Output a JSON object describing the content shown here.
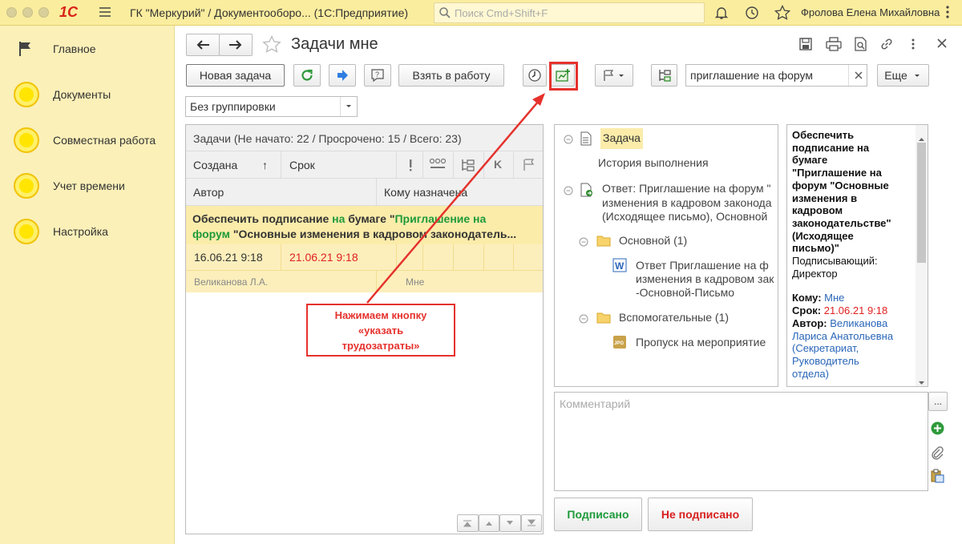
{
  "app": {
    "logo": "1С",
    "title": "ГК \"Меркурий\" / Документооборо...  (1С:Предприятие)",
    "search_placeholder": "Поиск Cmd+Shift+F",
    "user": "Фролова Елена Михайловна"
  },
  "sidebar": {
    "items": [
      {
        "label": "Главное"
      },
      {
        "label": "Документы"
      },
      {
        "label": "Совместная работа"
      },
      {
        "label": "Учет времени"
      },
      {
        "label": "Настройка"
      }
    ]
  },
  "form": {
    "title": "Задачи мне",
    "toolbar": {
      "new_task": "Новая задача",
      "take_to_work": "Взять в работу",
      "search_value": "приглашение на форум",
      "more": "Еще"
    },
    "grouping": "Без группировки"
  },
  "list": {
    "summary": "Задачи (Не начато: 22 / Просрочено: 15 / Всего: 23)",
    "columns": {
      "created": "Создана",
      "sort_arrow": "↑",
      "due": "Срок",
      "flag_k": "K",
      "author": "Автор",
      "assigned_to": "Кому назначена"
    },
    "rows": [
      {
        "title_part1": "Обеспечить подписание ",
        "title_part2": "на",
        "title_part3": " бумаге \"",
        "title_part4": "Приглашение на",
        "title_part5": "форум",
        "title_part6": " \"Основные изменения в кадровом законодатель...",
        "created": "16.06.21 9:18",
        "due": "21.06.21 9:18",
        "author": "Великанова Л.А.",
        "assigned_to": "Мне"
      }
    ]
  },
  "tree": {
    "task": "Задача",
    "history": "История выполнения",
    "answer_line1": "Ответ: Приглашение на форум \"",
    "answer_line2": "изменения в кадровом законода",
    "answer_line3": "(Исходящее письмо), Основной",
    "folder_main": "Основной (1)",
    "doc_line1": "Ответ  Приглашение на ф",
    "doc_line2": "изменения в кадровом зак",
    "doc_line3": "-Основной-Письмо",
    "folder_aux": "Вспомогательные (1)",
    "pass": "Пропуск на мероприятие"
  },
  "detail": {
    "heading": [
      "Обеспечить",
      "подписание на",
      "бумаге",
      "\"Приглашение на",
      "форум \"Основные",
      "изменения в",
      "кадровом",
      "законодательстве\"",
      "(Исходящее",
      "письмо)\""
    ],
    "signer_label": "Подписывающий:",
    "signer_value": "Директор",
    "to_label": "Кому:",
    "to_value": "Мне",
    "due_label": "Срок:",
    "due_value": "21.06.21 9:18",
    "author_label": "Автор:",
    "author_lines": [
      "Великанова",
      "Лариса Анатольевна",
      "(Секретариат,",
      "Руководитель",
      "отдела)"
    ]
  },
  "comment": {
    "placeholder": "Комментарий",
    "ellipsis": "..."
  },
  "actions": {
    "signed": "Подписано",
    "not_signed": "Не подписано"
  },
  "annotation": {
    "lines": [
      "Нажимаем кнопку",
      "«указать",
      "трудозатраты»"
    ]
  },
  "colors": {
    "accent_red": "#e5322d",
    "highlight": "#fbecaa",
    "green": "#1f9a3a",
    "link": "#2a66b8",
    "due_red": "#e02020"
  }
}
